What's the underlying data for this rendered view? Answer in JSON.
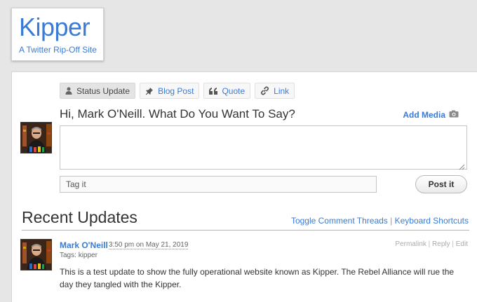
{
  "site": {
    "title": "Kipper",
    "tagline": "A Twitter Rip-Off Site"
  },
  "composer": {
    "tabs": [
      {
        "label": "Status Update",
        "icon": "person-icon",
        "active": true
      },
      {
        "label": "Blog Post",
        "icon": "pin-icon",
        "active": false
      },
      {
        "label": "Quote",
        "icon": "quote-icon",
        "active": false
      },
      {
        "label": "Link",
        "icon": "link-icon",
        "active": false
      }
    ],
    "prompt": "Hi, Mark O'Neill. What Do You Want To Say?",
    "add_media_label": "Add Media",
    "message_value": "",
    "tag_placeholder": "Tag it",
    "post_button_label": "Post it"
  },
  "updates_section": {
    "title": "Recent Updates",
    "toggle_threads_label": "Toggle Comment Threads",
    "separator": " | ",
    "keyboard_shortcuts_label": "Keyboard Shortcuts"
  },
  "updates": [
    {
      "author": "Mark O'Neill",
      "time": "3:50 pm on May 21, 2019",
      "tags_label": "Tags:",
      "tags": "kipper",
      "text": "This is a test update to show the fully operational website known as Kipper. The Rebel Alliance will rue the day they tangled with the Kipper.",
      "actions": {
        "permalink": "Permalink",
        "reply": "Reply",
        "edit": "Edit",
        "separator": " | "
      }
    }
  ],
  "colors": {
    "accent": "#3a7bd5",
    "background": "#e6e6e6",
    "panel": "#ffffff"
  }
}
